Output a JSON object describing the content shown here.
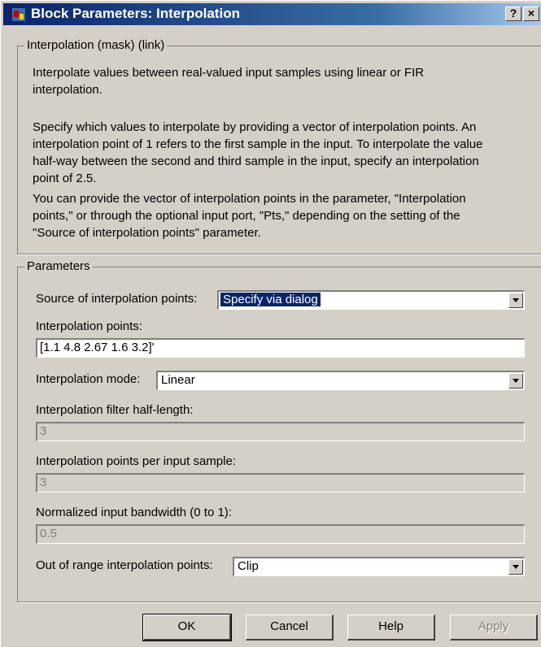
{
  "window": {
    "title": "Block Parameters: Interpolation",
    "help_button": "?",
    "close_button": "×"
  },
  "mask": {
    "legend": "Interpolation (mask) (link)",
    "description_lines": [
      "Interpolate values between real-valued input samples using linear or FIR",
      "interpolation.",
      "",
      "Specify which values to interpolate by providing a vector of interpolation points. An",
      "interpolation point of 1 refers to the first sample in the input.  To interpolate the value",
      "half-way between the second and third sample in the input, specify an interpolation",
      "point of 2.5.",
      "",
      "You can provide the vector of interpolation points in the parameter, \"Interpolation",
      "points,\" or through the optional input port, \"Pts,\" depending on the setting of the",
      "\"Source of interpolation points\" parameter."
    ]
  },
  "parameters": {
    "legend": "Parameters",
    "source_label": "Source of interpolation points:",
    "source_value": "Specify via dialog",
    "points_label": "Interpolation points:",
    "points_value": "[1.1 4.8 2.67 1.6 3.2]'",
    "mode_label": "Interpolation mode:",
    "mode_value": "Linear",
    "half_length_label": "Interpolation filter half-length:",
    "half_length_value": "3",
    "per_sample_label": "Interpolation points per input sample:",
    "per_sample_value": "3",
    "bandwidth_label": "Normalized input bandwidth (0 to 1):",
    "bandwidth_value": "0.5",
    "out_of_range_label": "Out of range interpolation points:",
    "out_of_range_value": "Clip"
  },
  "buttons": {
    "ok": "OK",
    "cancel": "Cancel",
    "help": "Help",
    "apply": "Apply"
  }
}
